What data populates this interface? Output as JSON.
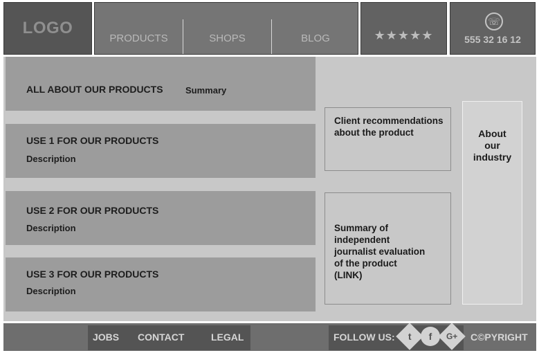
{
  "header": {
    "logo": "LOGO",
    "nav": [
      "PRODUCTS",
      "SHOPS",
      "BLOG"
    ],
    "rating_stars": "★★★★★",
    "phone_icon": "phone-icon",
    "phone_number": "555 32 16 12"
  },
  "main": {
    "sections": [
      {
        "title": "ALL ABOUT OUR PRODUCTS",
        "sub": "Summary"
      },
      {
        "title": "USE 1 FOR OUR PRODUCTS",
        "sub": "Description"
      },
      {
        "title": "USE 2 FOR OUR PRODUCTS",
        "sub": "Description"
      },
      {
        "title": "USE 3 FOR OUR PRODUCTS",
        "sub": "Description"
      }
    ],
    "client_card": [
      "Client recommendations",
      "about the product"
    ],
    "journalist_card": [
      "Summary of",
      "independent",
      "journalist evaluation",
      "of the product",
      "(LINK)"
    ],
    "industry": [
      "About",
      "our",
      "industry"
    ]
  },
  "footer": {
    "links": [
      "JOBS",
      "CONTACT",
      "LEGAL"
    ],
    "follow_label": "FOLLOW US:",
    "social": [
      {
        "icon": "twitter-icon",
        "glyph": "t"
      },
      {
        "icon": "facebook-icon",
        "glyph": "f"
      },
      {
        "icon": "google-plus-icon",
        "glyph": "G+"
      }
    ],
    "copyright": "C©PYRIGHT"
  }
}
